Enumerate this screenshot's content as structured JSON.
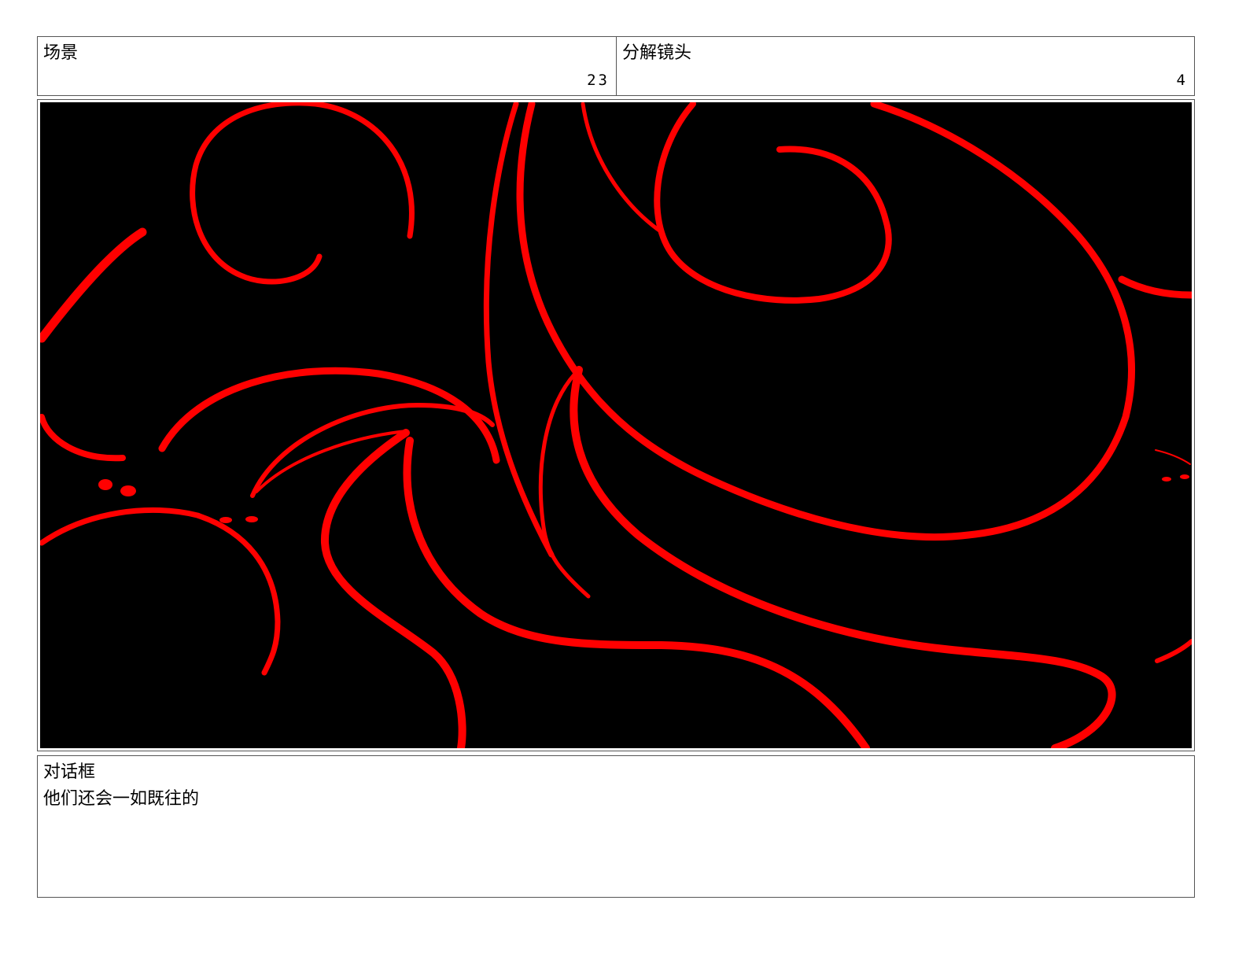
{
  "header": {
    "scene_label": "场景",
    "scene_number": "23",
    "shot_label": "分解镜头",
    "shot_number": "4"
  },
  "frame": {
    "background_color": "#000000",
    "stroke_color": "#ff0000"
  },
  "dialog": {
    "label": "对话框",
    "text": "他们还会一如既往的"
  }
}
